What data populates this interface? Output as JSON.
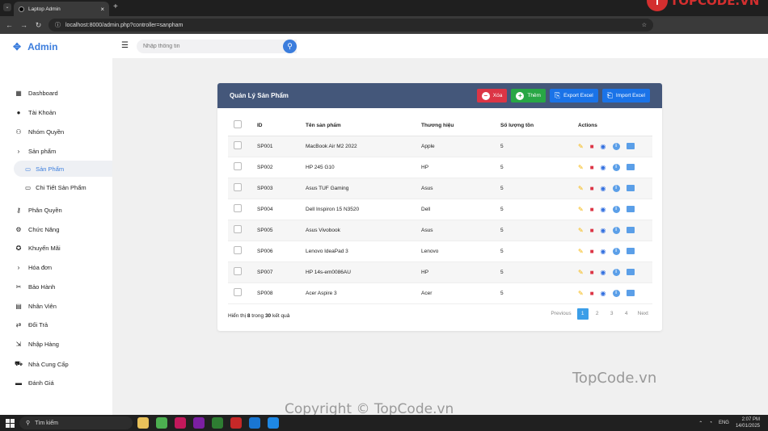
{
  "browser": {
    "tab_title": "Laptop Admin",
    "url": "localhost:8000/admin.php?controller=sanpham",
    "brand": "TOPCODE.VN"
  },
  "sidebar": {
    "title": "Admin",
    "items": [
      {
        "label": "Dashboard",
        "icon": "grid-icon"
      },
      {
        "label": "Tài Khoản",
        "icon": "user-icon"
      },
      {
        "label": "Nhóm Quyền",
        "icon": "users-icon"
      },
      {
        "label": "Sản phẩm",
        "icon": "chevron-right-icon"
      },
      {
        "label": "Sản Phẩm",
        "icon": "laptop-icon"
      },
      {
        "label": "Chi Tiết Sản Phẩm",
        "icon": "laptop-icon"
      },
      {
        "label": "Phân Quyền",
        "icon": "key-icon"
      },
      {
        "label": "Chức Năng",
        "icon": "cogs-icon"
      },
      {
        "label": "Khuyến Mãi",
        "icon": "badge-icon"
      },
      {
        "label": "Hóa đơn",
        "icon": "chevron-right-icon"
      },
      {
        "label": "Bảo Hành",
        "icon": "tools-icon"
      },
      {
        "label": "Nhân Viên",
        "icon": "id-card-icon"
      },
      {
        "label": "Đổi Trả",
        "icon": "exchange-icon"
      },
      {
        "label": "Nhập Hàng",
        "icon": "import-icon"
      },
      {
        "label": "Nhà Cung Cấp",
        "icon": "truck-icon"
      },
      {
        "label": "Đánh Giá",
        "icon": "comment-icon"
      }
    ]
  },
  "search": {
    "placeholder": "Nhập thông tin"
  },
  "card": {
    "title": "Quản Lý Sản Phẩm",
    "buttons": {
      "delete": "Xóa",
      "add": "Thêm",
      "export": "Export Excel",
      "import": "Import Excel"
    },
    "columns": [
      "ID",
      "Tên sản phẩm",
      "Thương hiệu",
      "Số lượng tồn",
      "Actions"
    ],
    "rows": [
      {
        "id": "SP001",
        "name": "MacBook Air M2 2022",
        "brand": "Apple",
        "stock": "5"
      },
      {
        "id": "SP002",
        "name": "HP 245 G10",
        "brand": "HP",
        "stock": "5"
      },
      {
        "id": "SP003",
        "name": "Asus TUF Gaming",
        "brand": "Asus",
        "stock": "5"
      },
      {
        "id": "SP004",
        "name": "Dell Inspiron 15 N3520",
        "brand": "Dell",
        "stock": "5"
      },
      {
        "id": "SP005",
        "name": "Asus Vivobook",
        "brand": "Asus",
        "stock": "5"
      },
      {
        "id": "SP006",
        "name": "Lenovo IdeaPad 3",
        "brand": "Lenovo",
        "stock": "5"
      },
      {
        "id": "SP007",
        "name": "HP 14s-em0086AU",
        "brand": "HP",
        "stock": "5"
      },
      {
        "id": "SP008",
        "name": "Acer Aspire 3",
        "brand": "Acer",
        "stock": "5"
      }
    ],
    "footer": {
      "prefix": "Hiển thị",
      "shown": "8",
      "mid": "trong",
      "total": "30",
      "suffix": "kết quả"
    },
    "pagination": {
      "previous": "Previous",
      "pages": [
        "1",
        "2",
        "3",
        "4"
      ],
      "next": "Next",
      "current": "1"
    }
  },
  "watermarks": {
    "top": "TopCode.vn",
    "bottom": "Copyright © TopCode.vn"
  },
  "taskbar": {
    "search_label": "Tìm kiếm",
    "lang": "ENG",
    "time": "2:07 PM",
    "date": "14/01/2025"
  },
  "colors": {
    "accent": "#3b7ddd",
    "header": "#44577a",
    "danger": "#dc3545",
    "success": "#28a745",
    "primary": "#1a73e8"
  }
}
